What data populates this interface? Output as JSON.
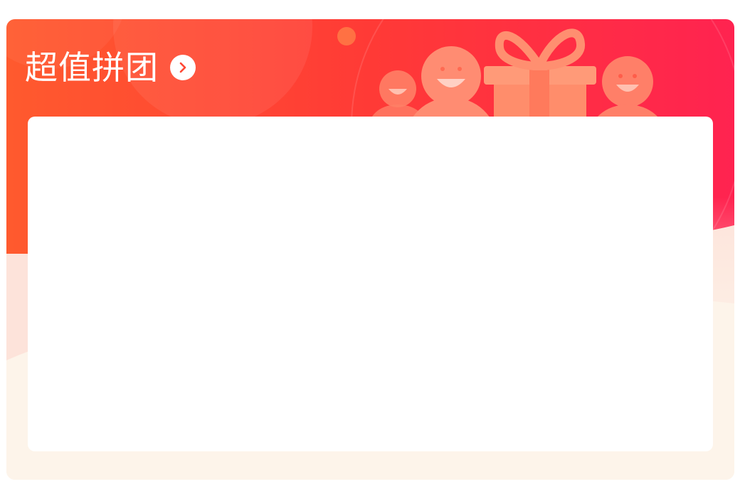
{
  "header": {
    "title": "超值拼团",
    "more_icon": "chevron-right-icon"
  },
  "colors": {
    "banner_start": "#ff5a2e",
    "banner_end": "#ff2350",
    "card_background": "#fdf4ea",
    "panel_background": "#ffffff",
    "arrow_color": "#ff4733"
  },
  "decorations": {
    "illustration": "group-buy-gift-illustration",
    "gift_icon": "gift-box-icon",
    "people_icon": "smiling-people-icon"
  }
}
